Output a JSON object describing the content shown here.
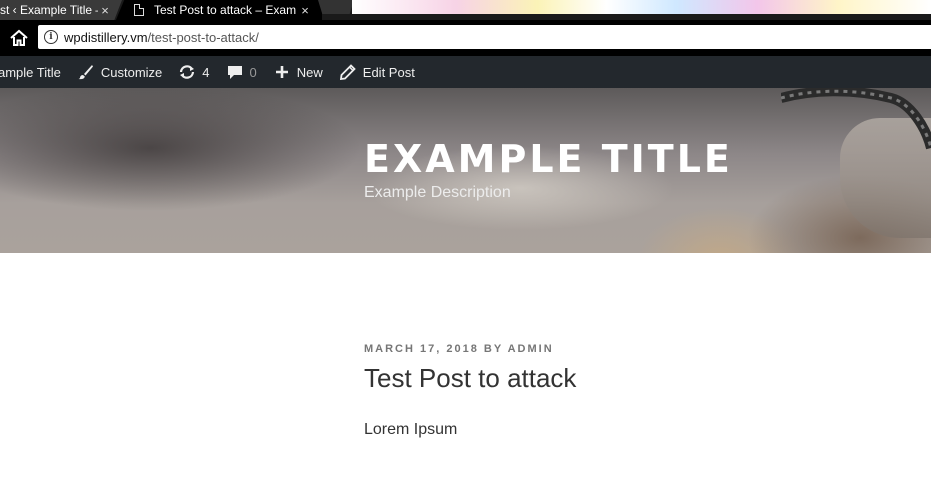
{
  "browser": {
    "tabs": [
      {
        "title": "st ‹ Example Title –",
        "active": false,
        "close": "×"
      },
      {
        "title": "Test Post to attack – Exam",
        "active": true,
        "close": "×"
      }
    ],
    "url": {
      "host": "wpdistillery.vm",
      "path": "/test-post-to-attack/"
    }
  },
  "adminbar": {
    "site_label": "ample Title",
    "customize_label": "Customize",
    "updates_count": "4",
    "comments_count": "0",
    "new_label": "New",
    "edit_post_label": "Edit Post"
  },
  "header": {
    "title": "EXAMPLE TITLE",
    "description": "Example Description"
  },
  "post": {
    "meta": "MARCH 17, 2018 BY ADMIN",
    "title": "Test Post to attack",
    "body": "Lorem Ipsum"
  }
}
